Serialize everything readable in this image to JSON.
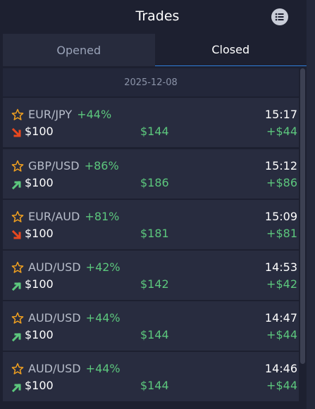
{
  "header": {
    "title": "Trades"
  },
  "tabs": [
    {
      "label": "Opened",
      "active": false
    },
    {
      "label": "Closed",
      "active": true
    }
  ],
  "date_separator": "2025-12-08",
  "colors": {
    "up": "#5cc77d",
    "down": "#e8481f",
    "star": "#f0a020",
    "accent": "#2f7fdc"
  },
  "trades": [
    {
      "pair": "EUR/JPY",
      "percent": "+44%",
      "time": "15:17",
      "direction": "down",
      "amount": "$100",
      "payout": "$144",
      "profit": "+$44"
    },
    {
      "pair": "GBP/USD",
      "percent": "+86%",
      "time": "15:12",
      "direction": "up",
      "amount": "$100",
      "payout": "$186",
      "profit": "+$86"
    },
    {
      "pair": "EUR/AUD",
      "percent": "+81%",
      "time": "15:09",
      "direction": "down",
      "amount": "$100",
      "payout": "$181",
      "profit": "+$81"
    },
    {
      "pair": "AUD/USD",
      "percent": "+42%",
      "time": "14:53",
      "direction": "up",
      "amount": "$100",
      "payout": "$142",
      "profit": "+$42"
    },
    {
      "pair": "AUD/USD",
      "percent": "+44%",
      "time": "14:47",
      "direction": "up",
      "amount": "$100",
      "payout": "$144",
      "profit": "+$44"
    },
    {
      "pair": "AUD/USD",
      "percent": "+44%",
      "time": "14:46",
      "direction": "up",
      "amount": "$100",
      "payout": "$144",
      "profit": "+$44"
    }
  ]
}
